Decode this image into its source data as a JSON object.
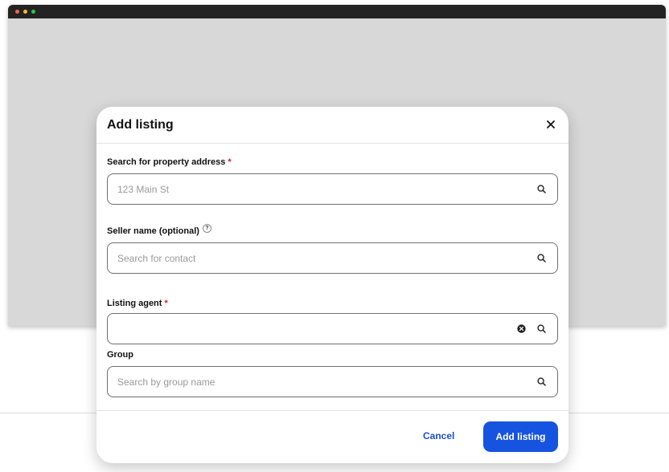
{
  "colors": {
    "window_red": "#ff5f57",
    "window_yellow": "#febc2e",
    "window_green": "#28c840",
    "accent": "#1654e0",
    "required": "#d0212b"
  },
  "modal": {
    "title": "Add listing",
    "close_icon": "close-icon",
    "fields": {
      "address": {
        "label": "Search for property address",
        "required_mark": "*",
        "placeholder": "123 Main St",
        "icon": "search-icon"
      },
      "seller": {
        "label": "Seller name (optional)",
        "help_mark": "?",
        "placeholder": "Search for contact",
        "icon": "search-icon"
      },
      "agent": {
        "label": "Listing agent",
        "required_mark": "*",
        "value": "",
        "clear_icon": "clear-icon",
        "icon": "search-icon"
      },
      "group": {
        "label": "Group",
        "placeholder": "Search by group name",
        "icon": "search-icon"
      }
    },
    "footer": {
      "cancel_label": "Cancel",
      "submit_label": "Add listing"
    }
  }
}
